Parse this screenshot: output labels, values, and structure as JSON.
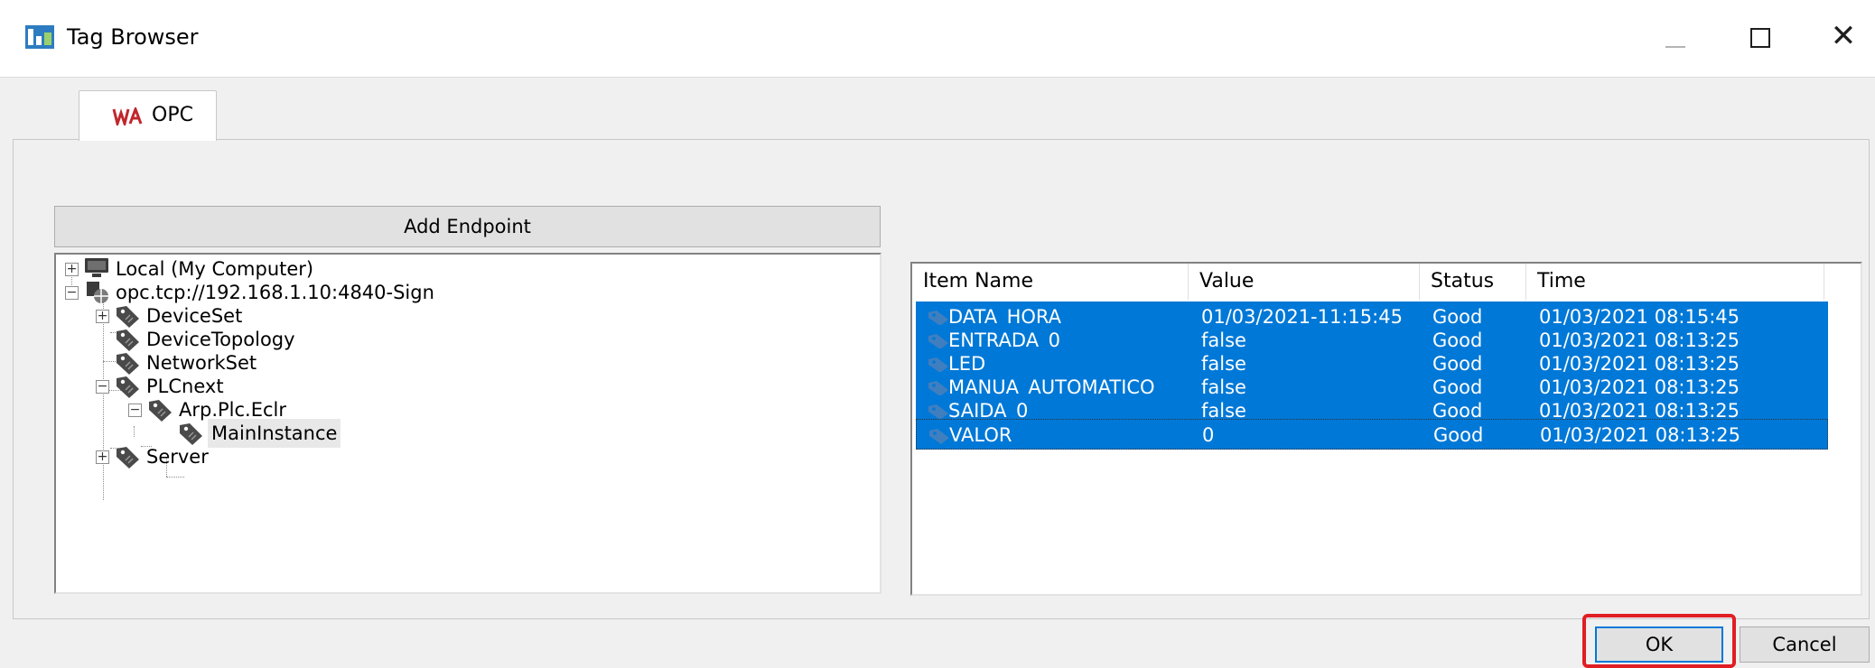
{
  "window": {
    "title": "Tag Browser",
    "close_glyph": "✕",
    "icons": {
      "app": "app-icon",
      "minimize": "minimize-icon",
      "maximize": "maximize-icon",
      "close": "close-icon"
    }
  },
  "tabs": [
    {
      "label": "OPC",
      "icon": "opc-tab-icon",
      "selected": true
    }
  ],
  "add_endpoint_label": "Add Endpoint",
  "tree": {
    "expand_glyph": "+",
    "collapse_glyph": "−",
    "nodes": [
      {
        "label": "Local (My Computer)",
        "icon": "computer-icon",
        "expander": "expand"
      },
      {
        "label": "opc.tcp://192.168.1.10:4840-Sign",
        "icon": "network-server-icon",
        "expander": "collapse"
      },
      {
        "label": "DeviceSet",
        "icon": "tag-icon",
        "expander": "expand"
      },
      {
        "label": "DeviceTopology",
        "icon": "tag-icon",
        "expander": "none"
      },
      {
        "label": "NetworkSet",
        "icon": "tag-icon",
        "expander": "none"
      },
      {
        "label": "PLCnext",
        "icon": "tag-icon",
        "expander": "collapse"
      },
      {
        "label": "Arp.Plc.Eclr",
        "icon": "tag-icon",
        "expander": "collapse"
      },
      {
        "label": "MainInstance",
        "icon": "tag-icon",
        "expander": "none",
        "selected": true
      },
      {
        "label": "Server",
        "icon": "tag-icon",
        "expander": "expand"
      }
    ]
  },
  "list": {
    "columns": [
      "Item Name",
      "Value",
      "Status",
      "Time"
    ],
    "rows": [
      {
        "name": "DATA_HORA",
        "value": "01/03/2021-11:15:45",
        "status": "Good",
        "time": "01/03/2021 08:15:45"
      },
      {
        "name": "ENTRADA_0",
        "value": "false",
        "status": "Good",
        "time": "01/03/2021 08:13:25"
      },
      {
        "name": "LED",
        "value": "false",
        "status": "Good",
        "time": "01/03/2021 08:13:25"
      },
      {
        "name": "MANUA_AUTOMATICO",
        "value": "false",
        "status": "Good",
        "time": "01/03/2021 08:13:25"
      },
      {
        "name": "SAIDA_0",
        "value": "false",
        "status": "Good",
        "time": "01/03/2021 08:13:25"
      },
      {
        "name": "VALOR",
        "value": "0",
        "status": "Good",
        "time": "01/03/2021 08:13:25"
      }
    ],
    "selection_color": "#0078d7"
  },
  "buttons": {
    "ok": "OK",
    "cancel": "Cancel"
  },
  "annotation": {
    "highlight_color": "#e01e24",
    "target": "ok-button"
  }
}
